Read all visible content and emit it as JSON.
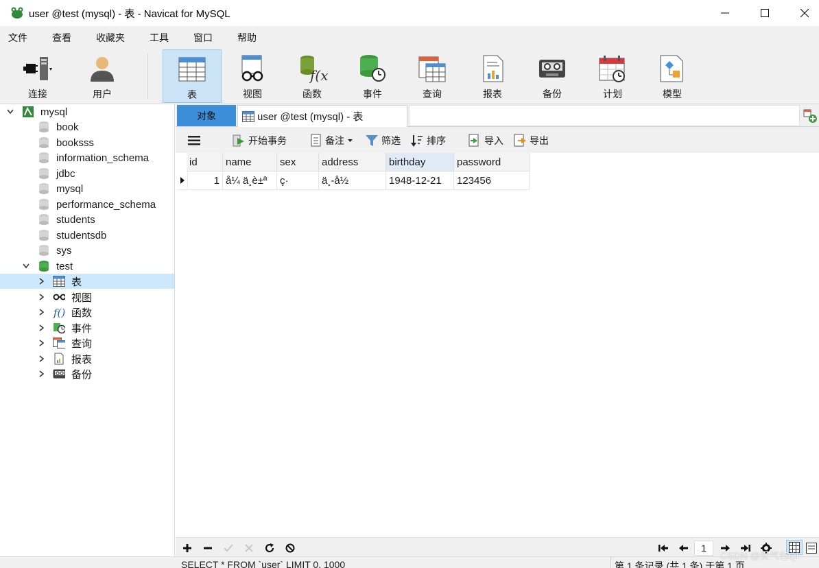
{
  "window": {
    "title": "user @test (mysql) - 表 - Navicat for MySQL"
  },
  "menu": [
    "文件",
    "查看",
    "收藏夹",
    "工具",
    "窗口",
    "帮助"
  ],
  "toolbar": {
    "items": [
      {
        "label": "连接",
        "icon": "plug-connection-icon"
      },
      {
        "label": "用户",
        "icon": "user-icon"
      },
      {
        "label": "表",
        "icon": "table-icon"
      },
      {
        "label": "视图",
        "icon": "view-glasses-icon"
      },
      {
        "label": "函数",
        "icon": "function-icon"
      },
      {
        "label": "事件",
        "icon": "event-icon"
      },
      {
        "label": "查询",
        "icon": "query-icon"
      },
      {
        "label": "报表",
        "icon": "report-icon"
      },
      {
        "label": "备份",
        "icon": "backup-icon"
      },
      {
        "label": "计划",
        "icon": "schedule-icon"
      },
      {
        "label": "模型",
        "icon": "model-icon"
      }
    ],
    "active": "表"
  },
  "sidebar": {
    "connection": "mysql",
    "databases": [
      "book",
      "booksss",
      "information_schema",
      "jdbc",
      "mysql",
      "performance_schema",
      "students",
      "studentsdb",
      "sys"
    ],
    "open_db": "test",
    "open_db_children": [
      "表",
      "视图",
      "函数",
      "事件",
      "查询",
      "报表",
      "备份"
    ]
  },
  "tabs": {
    "objects": "对象",
    "active": "user @test (mysql) - 表"
  },
  "subtoolbar": {
    "begin_tx": "开始事务",
    "note": "备注",
    "filter": "筛选",
    "sort": "排序",
    "import": "导入",
    "export": "导出"
  },
  "grid": {
    "columns": [
      "id",
      "name",
      "sex",
      "address",
      "birthday",
      "password"
    ],
    "rows": [
      [
        "1",
        "å¼ ä¸è±ª",
        "ç·",
        "ä¸-å½",
        "1948-12-21",
        "123456"
      ]
    ]
  },
  "nav": {
    "page": "1"
  },
  "status": {
    "sql": "SELECT * FROM `user` LIMIT 0, 1000",
    "records": "第 1 条记录 (共 1 条) 于第 1 页"
  },
  "watermark": "CSDN @受气包QI"
}
